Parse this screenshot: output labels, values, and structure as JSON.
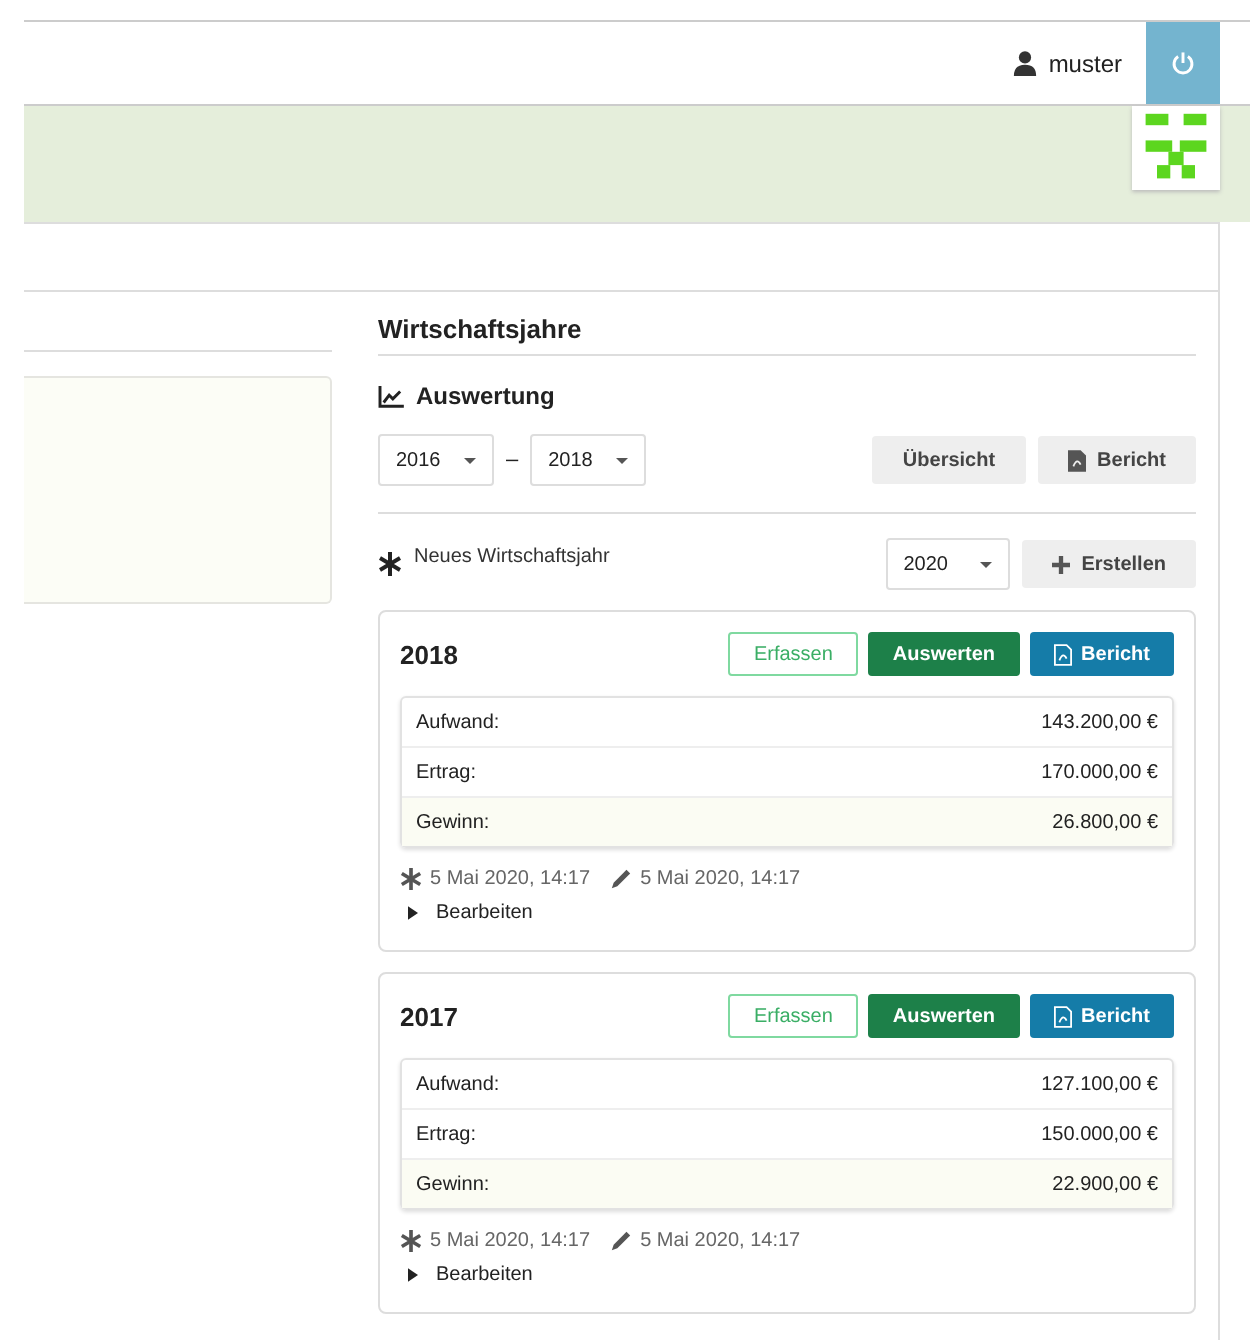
{
  "header": {
    "user": "muster"
  },
  "section": {
    "title": "Wirtschaftsjahre",
    "evaluation": {
      "title": "Auswertung",
      "from": "2016",
      "separator": "–",
      "to": "2018",
      "buttons": [
        {
          "label": "Übersicht",
          "kind": "overview"
        },
        {
          "label": "Bericht",
          "kind": "report"
        }
      ]
    },
    "new_year": {
      "label": "Neues Wirtschaftsjahr",
      "year": "2020",
      "button": "Erstellen"
    }
  },
  "years": [
    {
      "year": "2018",
      "buttons": [
        {
          "label": "Erfassen",
          "kind": "outline"
        },
        {
          "label": "Auswerten",
          "kind": "primary"
        },
        {
          "label": "Bericht",
          "kind": "report"
        }
      ],
      "rows": [
        {
          "label": "Aufwand:",
          "value": "143.200,00 €",
          "kind": "normal"
        },
        {
          "label": "Ertrag:",
          "value": "170.000,00 €",
          "kind": "normal"
        },
        {
          "label": "Gewinn:",
          "value": "26.800,00 €",
          "kind": "total"
        }
      ],
      "created": "5 Mai 2020, 14:17",
      "modified": "5 Mai 2020, 14:17",
      "edit": "Bearbeiten",
      "expanded": false
    },
    {
      "year": "2017",
      "buttons": [
        {
          "label": "Erfassen",
          "kind": "outline"
        },
        {
          "label": "Auswerten",
          "kind": "primary"
        },
        {
          "label": "Bericht",
          "kind": "report"
        }
      ],
      "rows": [
        {
          "label": "Aufwand:",
          "value": "127.100,00 €",
          "kind": "normal"
        },
        {
          "label": "Ertrag:",
          "value": "150.000,00 €",
          "kind": "normal"
        },
        {
          "label": "Gewinn:",
          "value": "22.900,00 €",
          "kind": "total"
        }
      ],
      "created": "5 Mai 2020, 14:17",
      "modified": "5 Mai 2020, 14:17",
      "edit": "Bearbeiten",
      "expanded": false
    }
  ]
}
